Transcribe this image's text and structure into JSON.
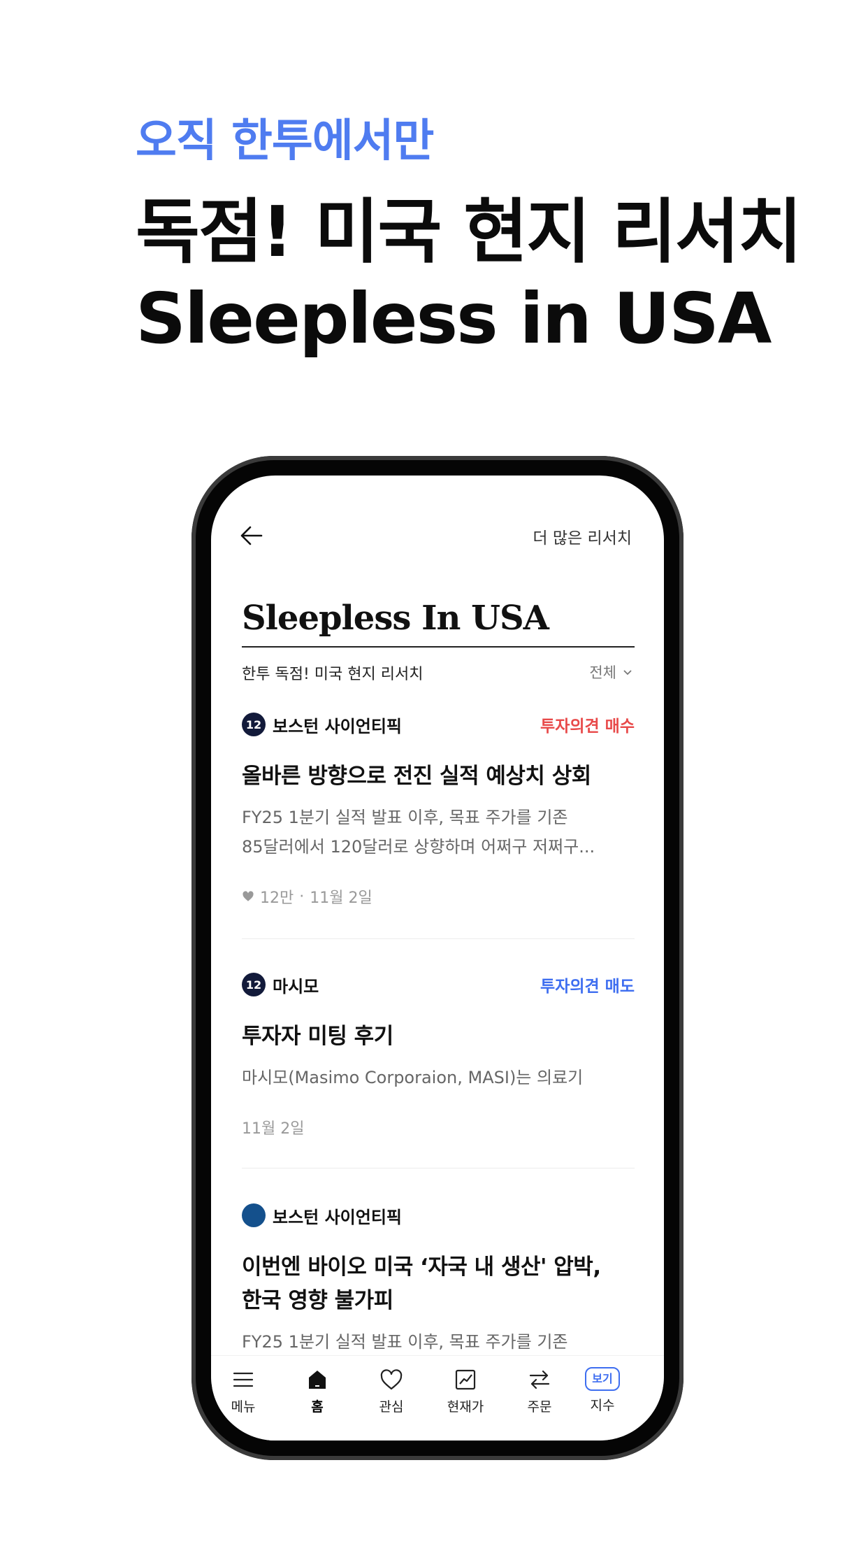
{
  "promo": {
    "subtitle": "오직 한투에서만",
    "headline_line1": "독점! 미국 현지 리서치",
    "headline_line2": "Sleepless in USA"
  },
  "header": {
    "back_icon": "arrow-left-icon",
    "more_link": "더 많은 리서치"
  },
  "brand": {
    "title": "Sleepless In USA",
    "subtitle": "한투 독점! 미국 현지 리서치",
    "filter_label": "전체"
  },
  "articles": [
    {
      "company": "보스턴 사이언티픽",
      "logo_text": "12",
      "opinion": "투자의견 매수",
      "opinion_color": "#e84a4a",
      "title": "올바른 방향으로 전진 실적 예상치 상회",
      "body_line1": "FY25 1분기 실적 발표 이후, 목표 주가를 기존",
      "body_line2": "85달러에서 120달러로 상향하며 어쩌구 저쩌구...",
      "likes": "12만",
      "date": "11월 2일"
    },
    {
      "company": "마시모",
      "logo_text": "12",
      "opinion": "투자의견 매도",
      "opinion_color": "#3e6ef0",
      "title": "투자자 미팅 후기",
      "body_line1": "마시모(Masimo Corporaion, MASI)는 의료기",
      "date": "11월 2일"
    },
    {
      "company": "보스턴 사이언티픽",
      "title_line1": "이번엔 바이오 미국 ‘자국 내 생산' 압박,",
      "title_line2": "한국 영향 불가피",
      "body_line1": "FY25 1분기 실적 발표 이후, 목표 주가를 기존"
    }
  ],
  "tabbar": {
    "items": [
      {
        "label": "메뉴",
        "icon": "menu-icon"
      },
      {
        "label": "홈",
        "icon": "home-icon"
      },
      {
        "label": "관심",
        "icon": "heart-icon"
      },
      {
        "label": "현재가",
        "icon": "chart-icon"
      },
      {
        "label": "주문",
        "icon": "swap-icon"
      },
      {
        "label": "지수",
        "icon": "bubble-icon",
        "badge": "보기"
      }
    ]
  },
  "colors": {
    "accent": "#4f7cf0",
    "buy": "#e84a4a",
    "sell": "#3e6ef0"
  }
}
